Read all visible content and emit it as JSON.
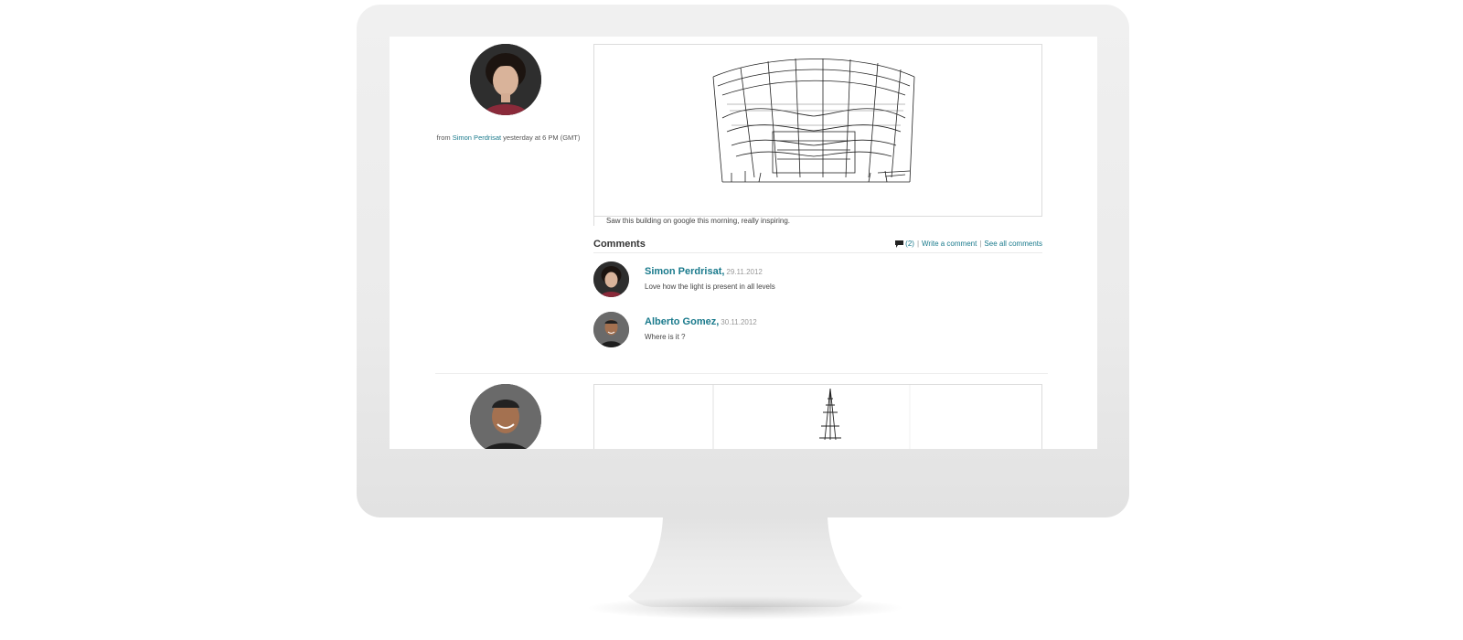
{
  "post1": {
    "byline_prefix": "from",
    "author": "Simon Perdrisat",
    "byline_time": "yesterday at 6 PM (GMT)",
    "caption": "Saw this building on google this morning, really inspiring."
  },
  "comments": {
    "title": "Comments",
    "count": "(2)",
    "separator": "|",
    "write_label": "Write a comment",
    "see_all_label": "See all comments",
    "items": [
      {
        "author": "Simon Perdrisat,",
        "date": "29.11.2012",
        "text": "Love how the light is present in all levels"
      },
      {
        "author": "Alberto Gomez,",
        "date": "30.11.2012",
        "text": "Where is it ?"
      }
    ]
  },
  "colors": {
    "link": "#1a7a8c",
    "monitor_bezel": "#ebebeb",
    "text": "#444444"
  },
  "icons": [
    "speech-bubble-icon"
  ]
}
